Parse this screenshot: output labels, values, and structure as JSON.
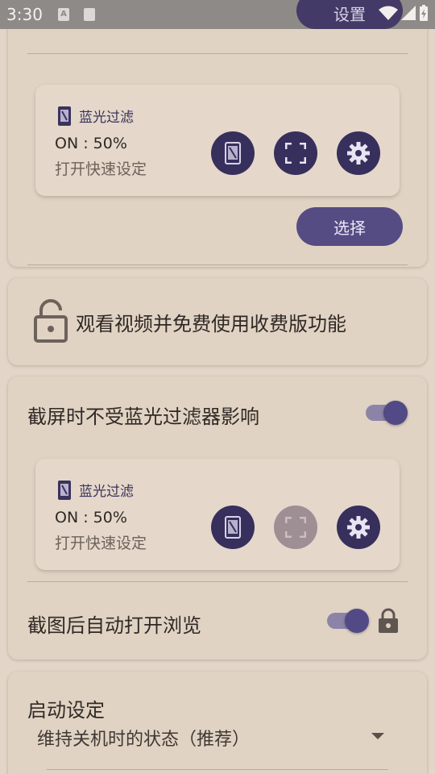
{
  "status_bar": {
    "time": "3:30",
    "notif_a": "A",
    "overlay_label": "设置"
  },
  "tile_top": {
    "title": "蓝光过滤",
    "status": "ON : 50%",
    "subtitle": "打开快速设定"
  },
  "select_button": {
    "label": "选择"
  },
  "unlock_card": {
    "label": "观看视频并免费使用收费版功能"
  },
  "screenshot_card": {
    "toggle_label": "截屏时不受蓝光过滤器影响",
    "toggle_on": true,
    "tile": {
      "title": "蓝光过滤",
      "status": "ON : 50%",
      "subtitle": "打开快速设定"
    },
    "auto_open_label": "截图后自动打开浏览",
    "auto_open_on": true
  },
  "startup_card": {
    "title": "启动设定",
    "selected": "维持关机时的状态（推荐）"
  },
  "colors": {
    "background": "#e3d5c7",
    "accent": "#372f5c",
    "accent_light": "#564c84",
    "disabled": "#9d8f93"
  }
}
